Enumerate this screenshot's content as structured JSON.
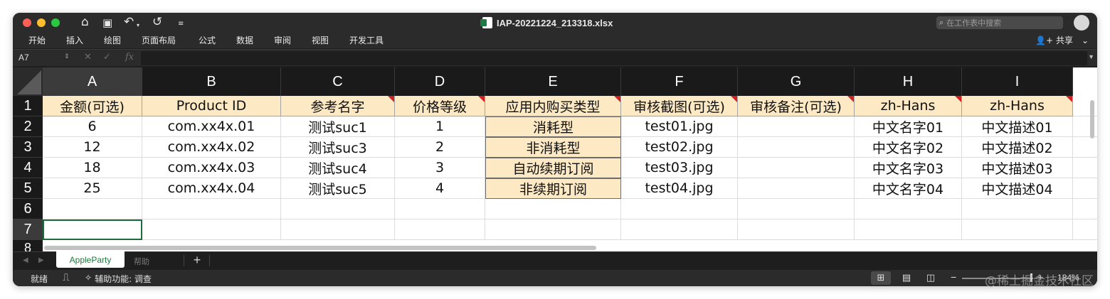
{
  "title_bar": {
    "document_title": "IAP-20221224_213318.xlsx",
    "search_placeholder": "在工作表中搜索",
    "quick_access": [
      "home-icon",
      "save-icon",
      "undo-icon",
      "redo-icon",
      "customize-icon"
    ]
  },
  "menu": {
    "items": [
      "开始",
      "插入",
      "绘图",
      "页面布局",
      "公式",
      "数据",
      "审阅",
      "视图",
      "开发工具"
    ],
    "share_label": "共享"
  },
  "formula_bar": {
    "name_box": "A7",
    "fx_label": "fx",
    "formula": ""
  },
  "sheet": {
    "columns": [
      "A",
      "B",
      "C",
      "D",
      "E",
      "F",
      "G",
      "H",
      "I"
    ],
    "rows": [
      "1",
      "2",
      "3",
      "4",
      "5",
      "6",
      "7"
    ],
    "row8_stub": "8",
    "header_row": [
      "金额(可选)",
      "Product ID",
      "参考名字",
      "价格等级",
      "应用内购买类型",
      "审核截图(可选)",
      "审核备注(可选)",
      "zh-Hans",
      "zh-Hans"
    ],
    "data_rows": [
      [
        "6",
        "com.xx4x.01",
        "测试suc1",
        "1",
        "消耗型",
        "test01.jpg",
        "",
        "中文名字01",
        "中文描述01"
      ],
      [
        "12",
        "com.xx4x.02",
        "测试suc3",
        "2",
        "非消耗型",
        "test02.jpg",
        "",
        "中文名字02",
        "中文描述02"
      ],
      [
        "18",
        "com.xx4x.03",
        "测试suc4",
        "3",
        "自动续期订阅",
        "test03.jpg",
        "",
        "中文名字03",
        "中文描述03"
      ],
      [
        "25",
        "com.xx4x.04",
        "测试suc5",
        "4",
        "非续期订阅",
        "test04.jpg",
        "",
        "中文名字04",
        "中文描述04"
      ]
    ],
    "active_cell": "A7",
    "colors": {
      "header_fill": "#fde9c3",
      "comment_marker": "#d21f1f",
      "selection": "#1b6e3a"
    }
  },
  "tabs": {
    "sheets": [
      "AppleParty",
      "帮助"
    ],
    "active": "AppleParty",
    "add_label": "+"
  },
  "status_bar": {
    "ready": "就绪",
    "accessibility_label": "辅助功能: 调查",
    "zoom": "184%",
    "zoom_minus": "−",
    "zoom_plus": "+"
  },
  "watermark": "@稀土掘金技术社区"
}
